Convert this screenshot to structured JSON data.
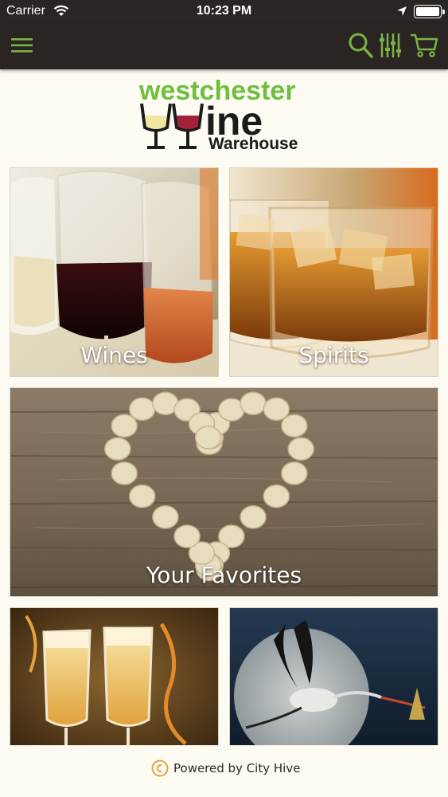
{
  "status_bar": {
    "carrier": "Carrier",
    "time": "10:23 PM"
  },
  "nav": {
    "menu_icon": "hamburger-icon",
    "search_icon": "search-icon",
    "filter_icon": "filter-icon",
    "cart_icon": "cart-icon",
    "accent_color": "#7bb446"
  },
  "logo": {
    "line1": "westchester",
    "line2": "ine",
    "line3": "Warehouse"
  },
  "tiles": [
    {
      "label": "Wines"
    },
    {
      "label": "Spirits"
    },
    {
      "label": "Your Favorites"
    },
    {
      "label": ""
    },
    {
      "label": ""
    }
  ],
  "footer": {
    "powered_by": "Powered by City Hive"
  }
}
